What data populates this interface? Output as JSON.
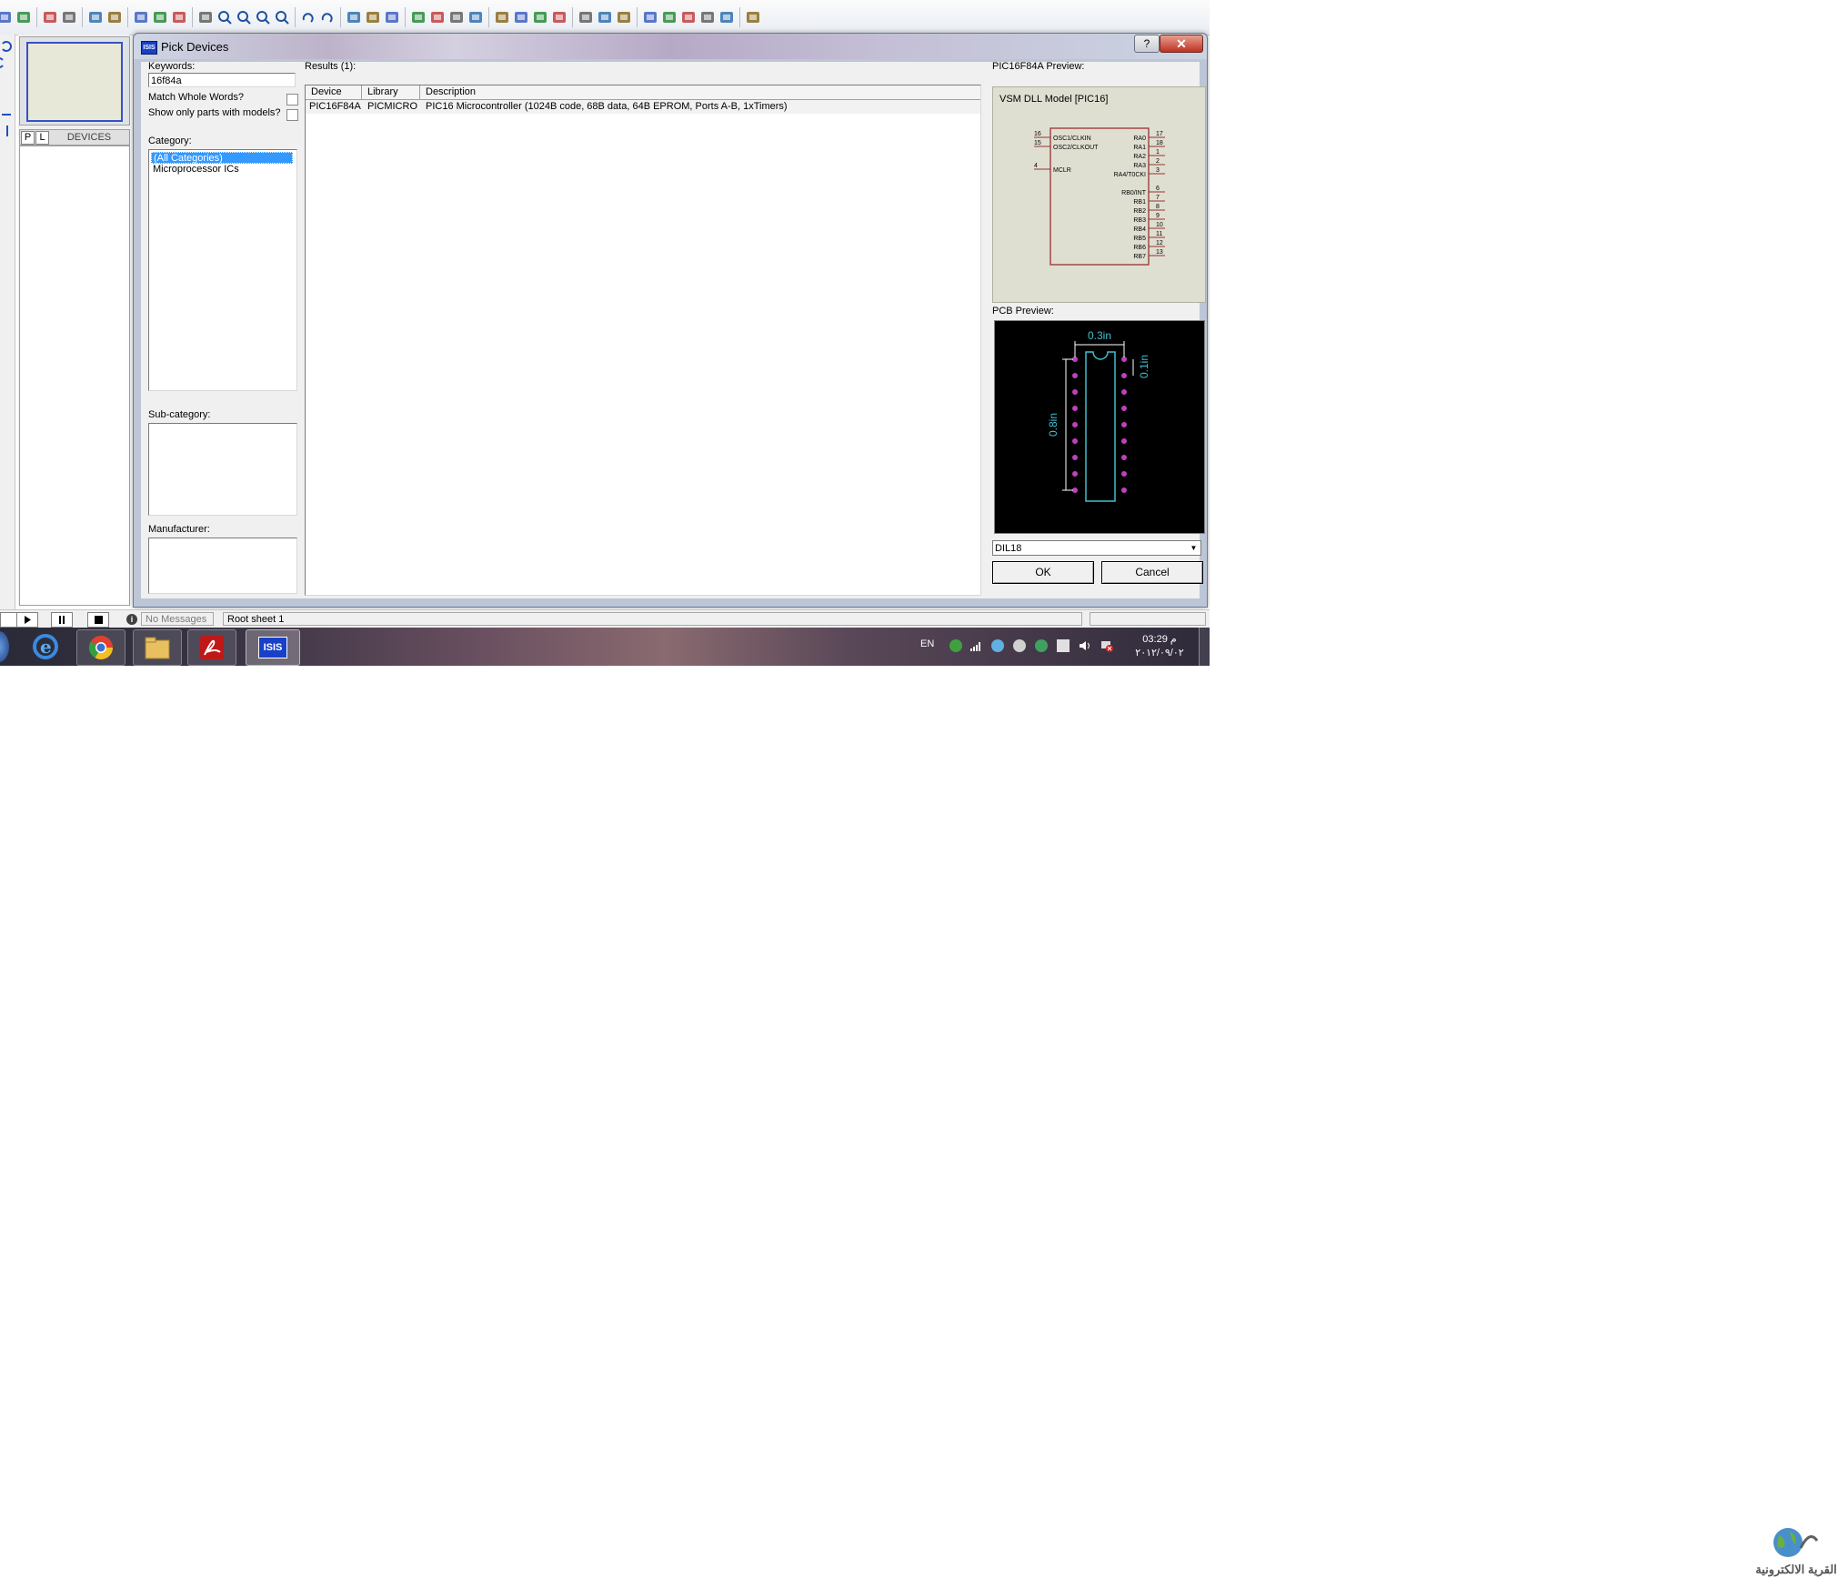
{
  "toolbar": {
    "icons": [
      "open-icon",
      "save-icon",
      "import-icon",
      "export-icon",
      "print-icon",
      "print-area-icon",
      "refresh-icon",
      "grid-icon",
      "origin-icon",
      "pan-icon",
      "zoom-in-icon",
      "zoom-out-icon",
      "zoom-all-icon",
      "zoom-area-icon",
      "undo-icon",
      "redo-icon",
      "cut-icon",
      "copy-icon",
      "paste-icon",
      "block-copy-icon",
      "block-move-icon",
      "block-rotate-icon",
      "block-delete-icon",
      "pick-device-icon",
      "make-device-icon",
      "packaging-tool-icon",
      "decompose-icon",
      "wire-autorouter-icon",
      "search-tag-icon",
      "property-tool-icon",
      "new-sheet-icon",
      "remove-sheet-icon",
      "goto-child-icon",
      "bill-of-materials-icon",
      "electrical-rules-icon",
      "netlist-to-ares-icon"
    ]
  },
  "left_panel": {
    "p_label": "P",
    "l_label": "L",
    "devices_label": "DEVICES"
  },
  "dialog": {
    "title": "Pick Devices",
    "icon_text": "ISIS",
    "help_label": "?",
    "close_label": "✕",
    "keywords_label": "Keywords:",
    "keywords_value": "16f84a",
    "match_whole_words_label": "Match Whole Words?",
    "show_only_models_label": "Show only parts with models?",
    "category_label": "Category:",
    "categories": [
      "(All Categories)",
      "Microprocessor ICs"
    ],
    "subcategory_label": "Sub-category:",
    "manufacturer_label": "Manufacturer:",
    "results_label": "Results (1):",
    "columns": [
      "Device",
      "Library",
      "Description"
    ],
    "rows": [
      {
        "device": "PIC16F84A",
        "library": "PICMICRO",
        "description": "PIC16 Microcontroller (1024B code, 68B data, 64B EPROM, Ports A-B, 1xTimers)"
      }
    ],
    "preview_label": "PIC16F84A Preview:",
    "vsm_label": "VSM DLL Model [PIC16]",
    "pcb_preview_label": "PCB Preview:",
    "package_value": "DIL18",
    "ok_label": "OK",
    "cancel_label": "Cancel"
  },
  "schematic": {
    "left_pins": [
      {
        "num": "16",
        "name": "OSC1/CLKIN"
      },
      {
        "num": "15",
        "name": "OSC2/CLKOUT"
      },
      {
        "num": "4",
        "name": "MCLR"
      }
    ],
    "right_pins": [
      {
        "num": "17",
        "name": "RA0"
      },
      {
        "num": "18",
        "name": "RA1"
      },
      {
        "num": "1",
        "name": "RA2"
      },
      {
        "num": "2",
        "name": "RA3"
      },
      {
        "num": "3",
        "name": "RA4/T0CKI"
      },
      {
        "num": "6",
        "name": "RB0/INT"
      },
      {
        "num": "7",
        "name": "RB1"
      },
      {
        "num": "8",
        "name": "RB2"
      },
      {
        "num": "9",
        "name": "RB3"
      },
      {
        "num": "10",
        "name": "RB4"
      },
      {
        "num": "11",
        "name": "RB5"
      },
      {
        "num": "12",
        "name": "RB6"
      },
      {
        "num": "13",
        "name": "RB7"
      }
    ]
  },
  "pcb": {
    "width_label": "0.3in",
    "pitch_label": "0.1in",
    "length_label": "0.8in",
    "pins_per_side": 9
  },
  "statusbar": {
    "messages": "No Messages",
    "sheet": "Root sheet 1"
  },
  "taskbar": {
    "apps": [
      "internet-explorer-icon",
      "chrome-icon",
      "file-explorer-icon",
      "acrobat-icon",
      "isis-icon"
    ],
    "isis_text": "ISIS",
    "language": "EN",
    "time": "03:29 م",
    "date": "٢٠١٢/٠٩/٠٢"
  },
  "watermark": {
    "text": "القرية الالكترونية"
  },
  "colors": {
    "selection": "#3399ff",
    "schematic_body": "#9a3030",
    "pcb_outline": "#40c0d0",
    "pcb_pad": "#c040c0"
  }
}
